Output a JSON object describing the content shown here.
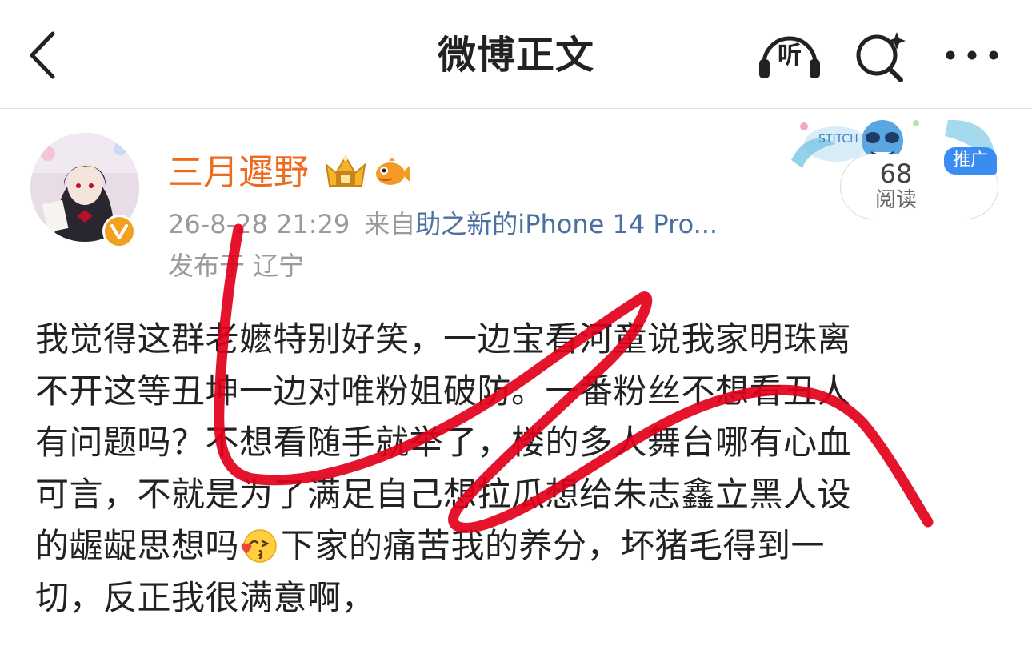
{
  "nav": {
    "title": "微博正文",
    "listen_label": "听",
    "icons": {
      "back": "chevron-left-icon",
      "listen": "headphones-icon",
      "search": "search-sparkle-icon",
      "more": "more-dots-icon"
    }
  },
  "post": {
    "author": {
      "name": "三月遲野",
      "avatar": "anime-girl-avatar",
      "badges": [
        "crown-badge-icon",
        "fish-badge-icon",
        "verified-v-badge-icon"
      ],
      "name_color": "#f06a1d"
    },
    "meta": {
      "time": "26-8-28 21:29",
      "from_label": "来自",
      "device": "助之新的iPhone 14 Pro...",
      "location": "发布于 辽宁"
    },
    "read_card": {
      "count": "68",
      "label": "阅读",
      "badge": "推广"
    },
    "body_lines": [
      "我觉得这群老嬷特别好笑，一边宝看河童说我家明珠离",
      "不开这等丑坤一边对唯粉姐破防。一番粉丝不想看丑人",
      "有问题吗？不想看随手就举了，楼的多人舞台哪有心血",
      "可言，不就是为了满足自己想拉瓜想给朱志鑫立黑人设",
      "的龌龊思想吗",
      "下家的痛苦我的养分，坏猪毛得到一",
      "切，反正我很满意啊，"
    ],
    "emoji": "kissing-face-emoji"
  },
  "colors": {
    "accent_orange": "#f06a1d",
    "link_blue": "#4b6fa3",
    "meta_gray": "#9a9a9a",
    "promo_blue": "#3b8cf0",
    "scribble_red": "#e3001b"
  }
}
